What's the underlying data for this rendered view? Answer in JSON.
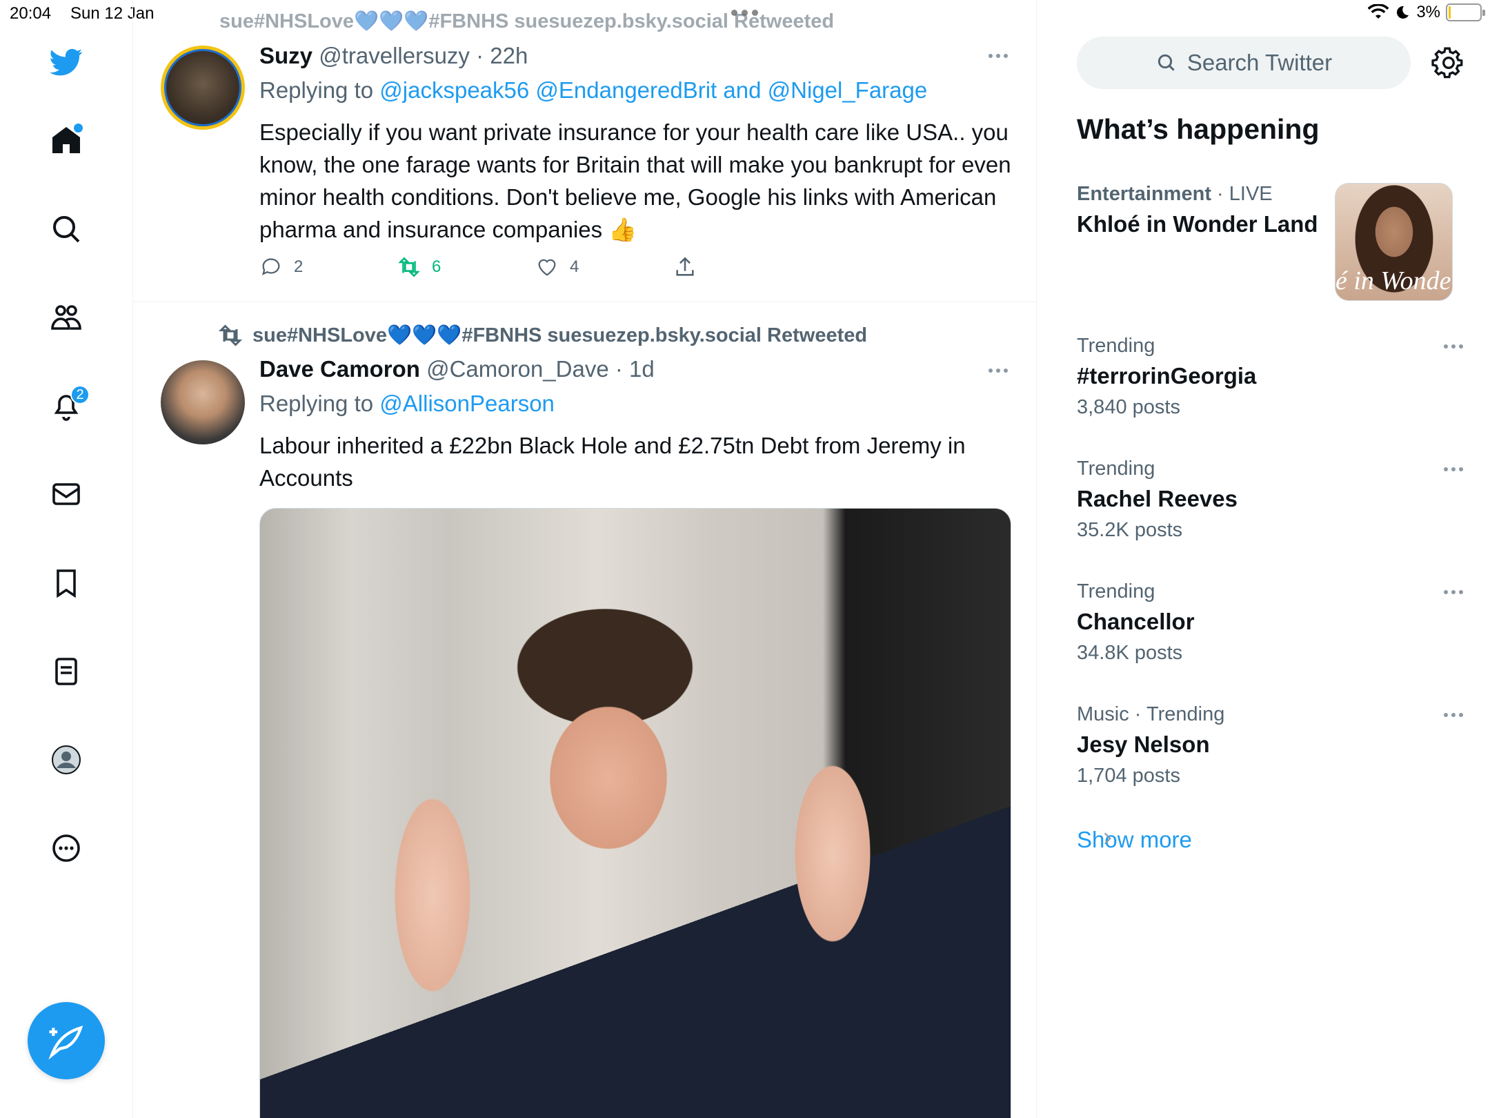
{
  "status_bar": {
    "time": "20:04",
    "date": "Sun 12 Jan",
    "battery": "3%",
    "battery_level": 0.03
  },
  "nav": {
    "notifications_badge": "2",
    "items": [
      "home-icon",
      "search-icon",
      "communities-icon",
      "notifications-icon",
      "messages-icon",
      "bookmarks-icon",
      "lists-icon",
      "profile-icon",
      "more-icon"
    ]
  },
  "timeline": {
    "tweets": [
      {
        "name": "Suzy",
        "handle": "@travellersuzy",
        "time": "· 22h",
        "replying_prefix": "Replying to",
        "replying_to": "@jackspeak56 @EndangeredBrit and @Nigel_Farage",
        "text": "Especially if you want private insurance for your health care like USA.. you know, the one farage wants for Britain that will make you bankrupt for even minor health conditions. Don't believe me, Google his links with American pharma and insurance companies 👍",
        "replies": "2",
        "retweets": "6",
        "likes": "4"
      },
      {
        "retweeted_by": "sue#NHSLove💙💙💙#FBNHS suesuezep.bsky.social Retweeted",
        "name": "Dave Camoron",
        "handle": "@Camoron_Dave",
        "time": "· 1d",
        "replying_prefix": "Replying to",
        "replying_to": "@AllisonPearson",
        "text": "Labour inherited a £22bn Black Hole and £2.75tn Debt from Jeremy in Accounts"
      }
    ]
  },
  "sidebar": {
    "search_placeholder": "Search Twitter",
    "section_title": "What’s happening",
    "featured": {
      "category": "Entertainment",
      "live": "· LIVE",
      "title": "Khloé in Wonder Land",
      "thumb_text": "é in Wonder L"
    },
    "trends": [
      {
        "category": "Trending",
        "title": "#terrorinGeorgia",
        "count": "3,840 posts"
      },
      {
        "category": "Trending",
        "title": "Rachel Reeves",
        "count": "35.2K posts"
      },
      {
        "category": "Trending",
        "title": "Chancellor",
        "count": "34.8K posts"
      },
      {
        "category": "Music · Trending",
        "title": "Jesy Nelson",
        "count": "1,704 posts"
      }
    ],
    "show_more": "Show more"
  },
  "colors": {
    "accent": "#1d9bf0",
    "retweet": "#00ba7c",
    "secondary_text": "#536471"
  }
}
